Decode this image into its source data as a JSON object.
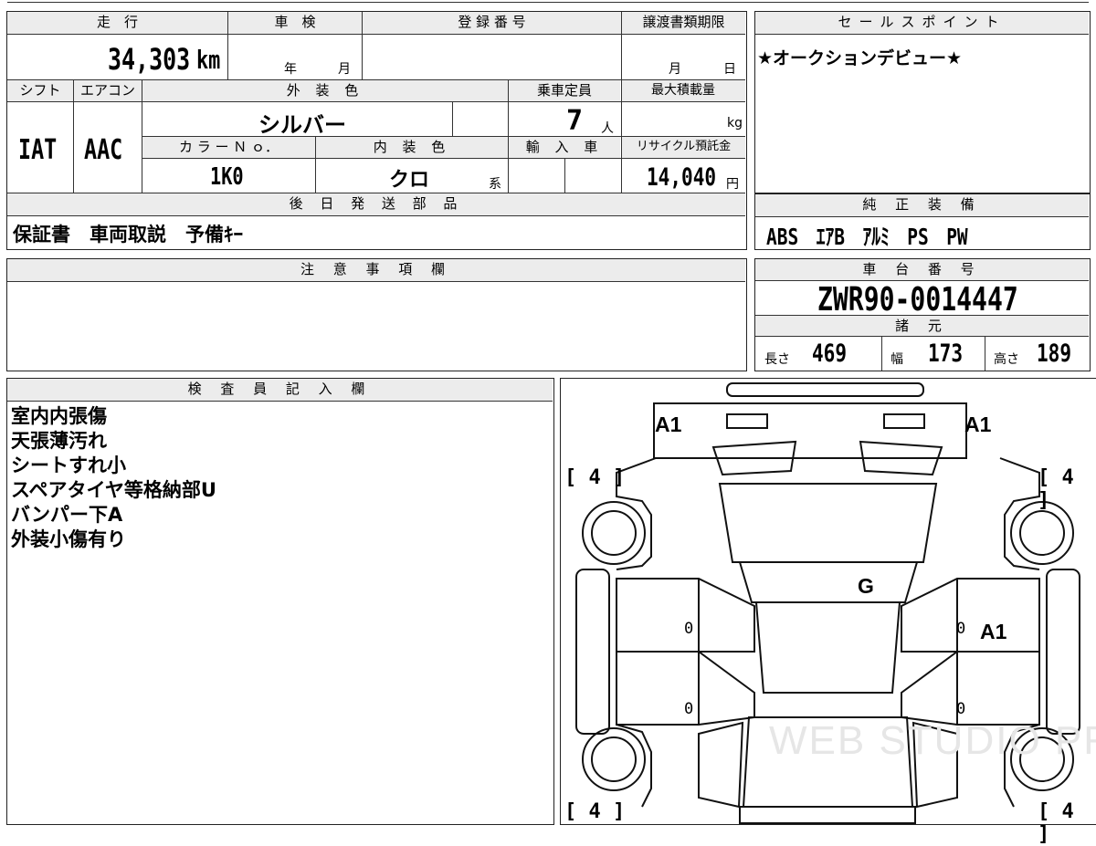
{
  "top_form": {
    "mileage_label": "走　行",
    "mileage_value": "34,303",
    "mileage_unit": "km",
    "shaken_label": "車　検",
    "shaken_year": "年",
    "shaken_month": "月",
    "reg_label": "登 録 番 号",
    "transfer_label": "譲渡書類期限",
    "transfer_month": "月",
    "transfer_day": "日",
    "shift_label": "シフト",
    "shift_value": "IAT",
    "ac_label": "エアコン",
    "ac_value": "AAC",
    "ext_color_label": "外 装 色",
    "ext_color_value": "シルバー",
    "capacity_label": "乗車定員",
    "capacity_value": "7",
    "capacity_unit": "人",
    "max_load_label": "最大積載量",
    "max_load_unit": "kg",
    "color_no_label": "カ ラ ー Ｎ ｏ．",
    "color_no_value": "1K0",
    "int_color_label": "内 装 色",
    "int_color_value": "クロ",
    "int_color_suffix": "系",
    "import_label": "輸 入 車",
    "recycle_label": "リサイクル預託金",
    "recycle_value": "14,040",
    "recycle_unit": "円",
    "later_parts_label": "後 日 発 送 部 品",
    "later_parts_value": "保証書　車両取説　予備ｷｰ"
  },
  "sales_point": {
    "label": "セールスポイント",
    "text": "★オークションデビュー★"
  },
  "genuine_equipment": {
    "label": "純 正 装 備",
    "value": "ABS　ｴｱB　ｱﾙﾐ　PS　PW"
  },
  "caution": {
    "label": "注 意 事 項 欄"
  },
  "chassis": {
    "label": "車 台 番 号",
    "value": "ZWR90-0014447"
  },
  "specs": {
    "label": "諸 元",
    "length_label": "長さ",
    "length_value": "469",
    "width_label": "幅",
    "width_value": "173",
    "height_label": "高さ",
    "height_value": "189"
  },
  "inspector": {
    "label": "検 査 員 記 入 欄",
    "notes": [
      "室内内張傷",
      "天張薄汚れ",
      "シートすれ小",
      "スペアタイヤ等格納部U",
      "バンパー下A",
      "外装小傷有り"
    ]
  },
  "diagram": {
    "tire_marks": [
      "[ 4 ]",
      "[ 4 ]",
      "[ 4 ]",
      "[ 4 ]"
    ],
    "damage_marks": [
      "A1",
      "A1",
      "G",
      "A1"
    ],
    "panel_zeros": [
      "0",
      "0",
      "0",
      "0"
    ],
    "watermark": "WEB STUDIO PRO"
  }
}
